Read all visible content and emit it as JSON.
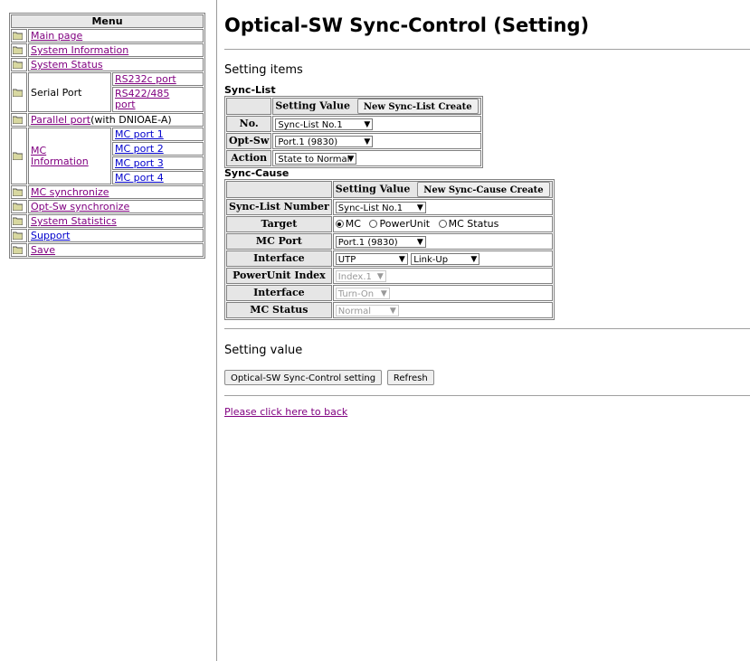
{
  "menu": {
    "title": "Menu",
    "main_page": "Main page",
    "system_information": "System Information",
    "system_status": "System Status",
    "serial_port": "Serial Port",
    "rs232c_port": "RS232c port",
    "rs422_485_port_line1": "RS422/485",
    "rs422_485_port_line2": "port",
    "parallel_port_link": "Parallel port",
    "parallel_port_suffix": "(with DNIOAE-A)",
    "mc_information_line1": "MC",
    "mc_information_line2": "Information",
    "mc_port_1": "MC port 1",
    "mc_port_2": "MC port 2",
    "mc_port_3": "MC port 3",
    "mc_port_4": "MC port 4",
    "mc_synchronize": "MC synchronize",
    "opt_sw_synchronize": "Opt-Sw synchronize",
    "system_statistics": "System Statistics",
    "support": "Support",
    "save": "Save"
  },
  "page": {
    "title": "Optical-SW Sync-Control (Setting)",
    "setting_items": "Setting items",
    "setting_value": "Setting value",
    "back_link": "Please click here to back"
  },
  "sync_list": {
    "label": "Sync-List",
    "header_setting_value": "Setting Value",
    "create_button": "New Sync-List Create",
    "no_label": "No.",
    "no_value": "Sync-List No.1",
    "opt_sw_label": "Opt-Sw",
    "opt_sw_value": "Port.1 (9830)",
    "action_label": "Action",
    "action_value": "State to Normal"
  },
  "sync_cause": {
    "label": "Sync-Cause",
    "header_setting_value": "Setting Value",
    "create_button": "New Sync-Cause Create",
    "sync_list_number_label": "Sync-List Number",
    "sync_list_number_value": "Sync-List No.1",
    "target_label": "Target",
    "target_options": [
      "MC",
      "PowerUnit",
      "MC Status"
    ],
    "target_selected": "MC",
    "mc_port_label": "MC Port",
    "mc_port_value": "Port.1 (9830)",
    "interface_label": "Interface",
    "interface_value_1": "UTP",
    "interface_value_2": "Link-Up",
    "powerunit_index_label": "PowerUnit Index",
    "powerunit_index_value": "Index.1",
    "interface2_label": "Interface",
    "interface2_value": "Turn-On",
    "mc_status_label": "MC Status",
    "mc_status_value": "Normal"
  },
  "buttons": {
    "setting": "Optical-SW Sync-Control setting",
    "refresh": "Refresh"
  },
  "colors": {
    "link_visited": "#800080",
    "link": "#0000cc",
    "label_bg": "#e6e6e6"
  }
}
